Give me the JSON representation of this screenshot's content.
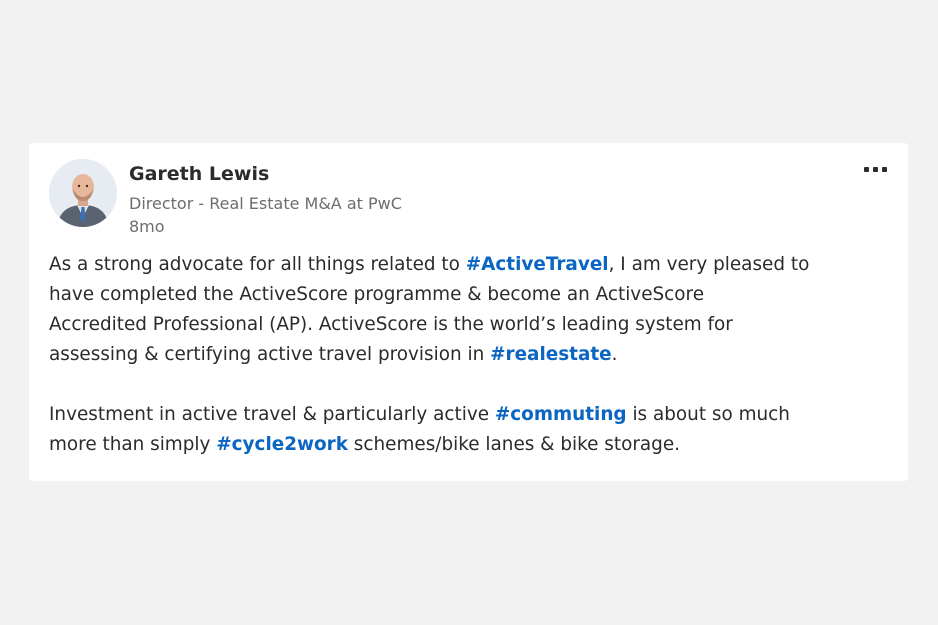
{
  "post": {
    "author": {
      "name": "Gareth Lewis",
      "headline": "Director - Real Estate M&A at PwC",
      "age": "8mo",
      "avatar_icon": "profile-photo"
    },
    "more_icon": "ellipsis-icon",
    "paragraph1": {
      "t1": "As a strong advocate for all things related to ",
      "tag1": "#ActiveTravel",
      "t2": ", I am very pleased to",
      "t3": "have completed the ActiveScore programme & become an ActiveScore",
      "t4": "Accredited Professional (AP). ActiveScore is the world’s leading system for",
      "t5": "assessing & certifying active travel provision in ",
      "tag2": "#realestate",
      "t6": "."
    },
    "paragraph2": {
      "t1": "Investment in active travel & particularly active ",
      "tag1": "#commuting",
      "t2": " is about so much",
      "t3": "more than simply ",
      "tag2": "#cycle2work",
      "t4": " schemes/bike lanes & bike storage."
    }
  },
  "colors": {
    "page_background": "#f2f2f2",
    "card_background": "#ffffff",
    "text": "#2b2b2b",
    "muted_text": "#6d6d6d",
    "hashtag": "#0a66c2"
  }
}
